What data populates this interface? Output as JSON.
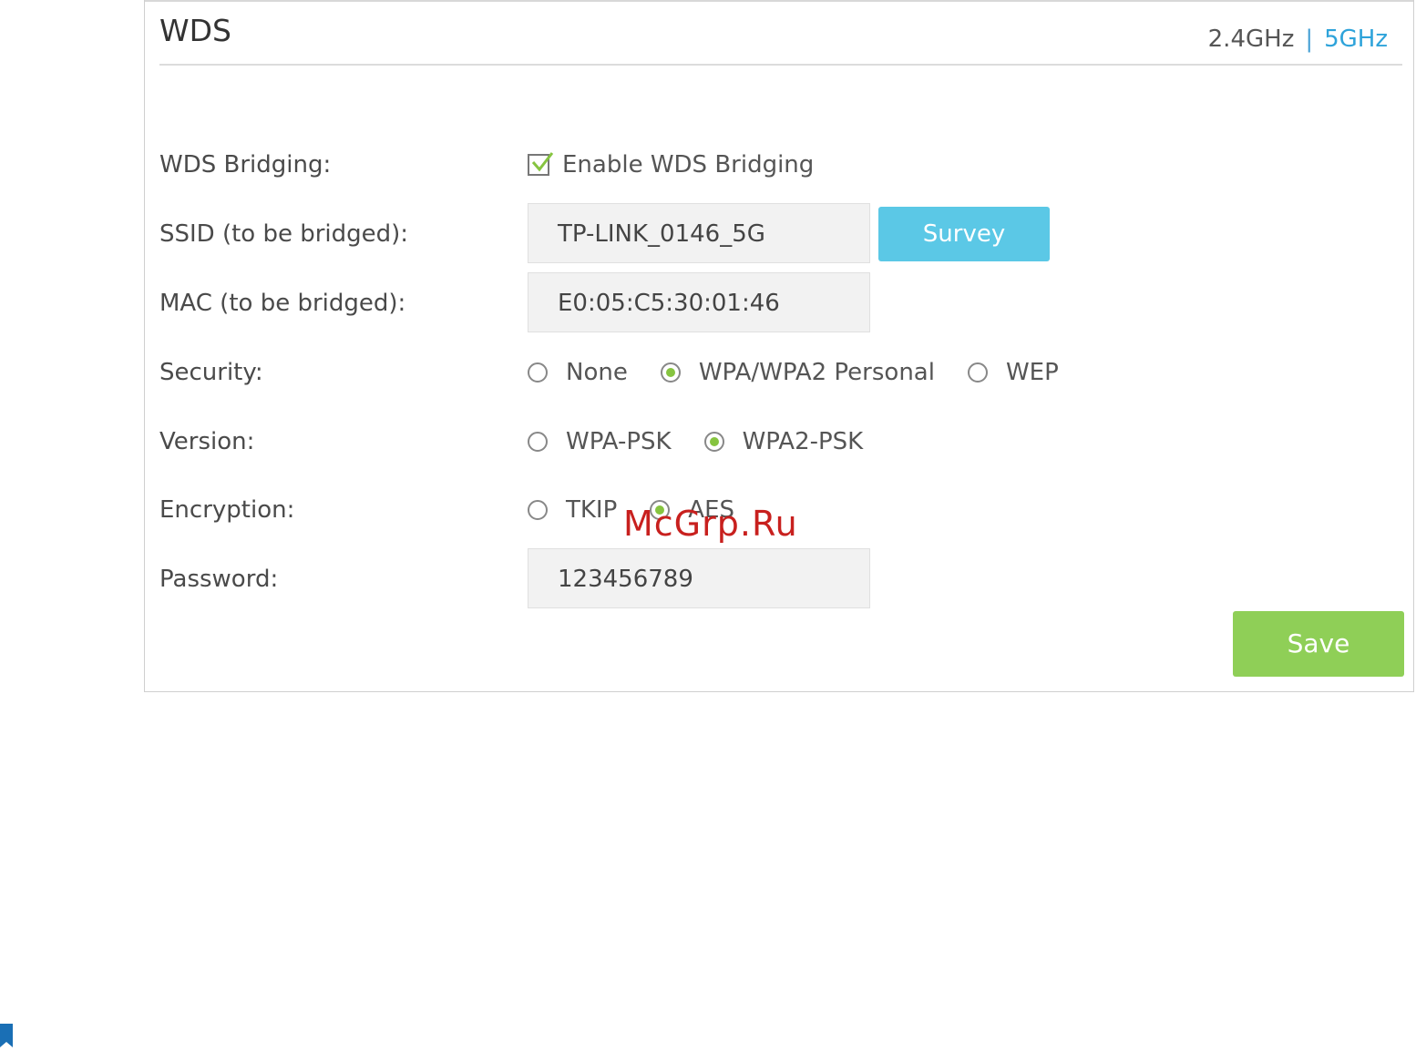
{
  "panel": {
    "title": "WDS",
    "bands": {
      "band_24": "2.4GHz",
      "separator": "|",
      "band_5": "5GHz",
      "active": "5GHz"
    }
  },
  "form": {
    "wds_bridging": {
      "label": "WDS Bridging:",
      "checkbox_label": "Enable WDS Bridging",
      "checked": true
    },
    "ssid": {
      "label": "SSID (to be bridged):",
      "value": "TP-LINK_0146_5G",
      "survey_label": "Survey"
    },
    "mac": {
      "label": "MAC (to be bridged):",
      "value": "E0:05:C5:30:01:46"
    },
    "security": {
      "label": "Security:",
      "options": [
        "None",
        "WPA/WPA2 Personal",
        "WEP"
      ],
      "selected": "WPA/WPA2 Personal"
    },
    "version": {
      "label": "Version:",
      "options": [
        "WPA-PSK",
        "WPA2-PSK"
      ],
      "selected": "WPA2-PSK"
    },
    "encryption": {
      "label": "Encryption:",
      "options": [
        "TKIP",
        "AES"
      ],
      "selected": "AES"
    },
    "password": {
      "label": "Password:",
      "value": "123456789"
    },
    "save_label": "Save"
  },
  "watermark": "McGrp.Ru",
  "colors": {
    "accent_green": "#86c440",
    "survey_blue": "#5bc8e6",
    "save_green": "#8fcf57",
    "link_blue": "#2ea3da",
    "watermark_red": "#c8201e"
  }
}
